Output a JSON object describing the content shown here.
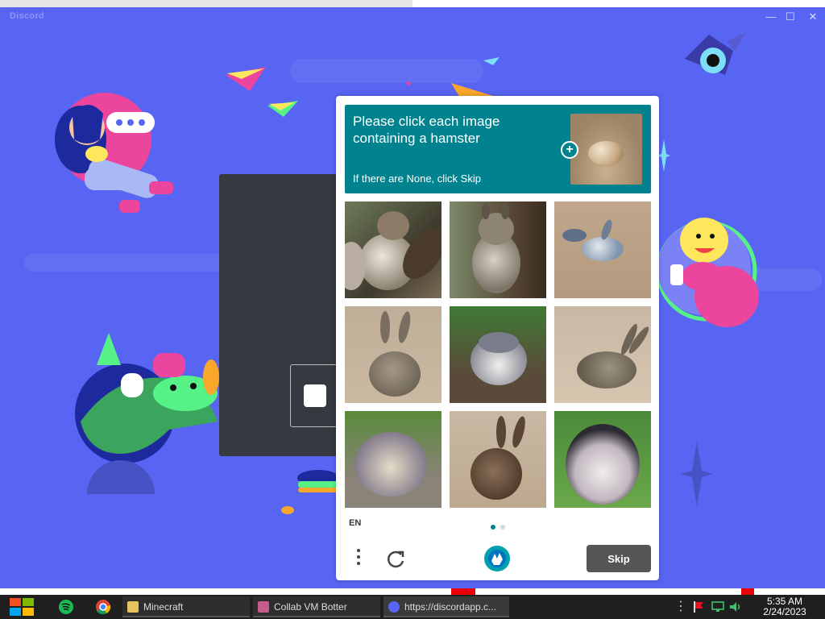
{
  "window": {
    "title": "Discord",
    "controls": [
      "minimize",
      "maximize",
      "close"
    ]
  },
  "captcha": {
    "prompt": "Please click each image containing a hamster",
    "prompt_sub": "If there are None, click Skip",
    "language": "EN",
    "skip_label": "Skip",
    "accent": "#00838f",
    "tiles": [
      {
        "subject": "squirrel"
      },
      {
        "subject": "squirrel"
      },
      {
        "subject": "bird"
      },
      {
        "subject": "rabbit"
      },
      {
        "subject": "hamster"
      },
      {
        "subject": "rabbit"
      },
      {
        "subject": "hamster"
      },
      {
        "subject": "rabbit"
      },
      {
        "subject": "hamster"
      }
    ],
    "pages": 2,
    "current_page": 1
  },
  "taskbar": {
    "tasks": [
      {
        "label": "Minecraft",
        "icon": "folder-icon"
      },
      {
        "label": "Collab VM Botter",
        "icon": "app-icon"
      },
      {
        "label": "https://discordapp.c...",
        "icon": "discord-icon"
      }
    ],
    "clock_time": "5:35 AM",
    "clock_date": "2/24/2023"
  },
  "colors": {
    "discord_blurple": "#5865f2",
    "taskbar": "#1f1f1f"
  }
}
